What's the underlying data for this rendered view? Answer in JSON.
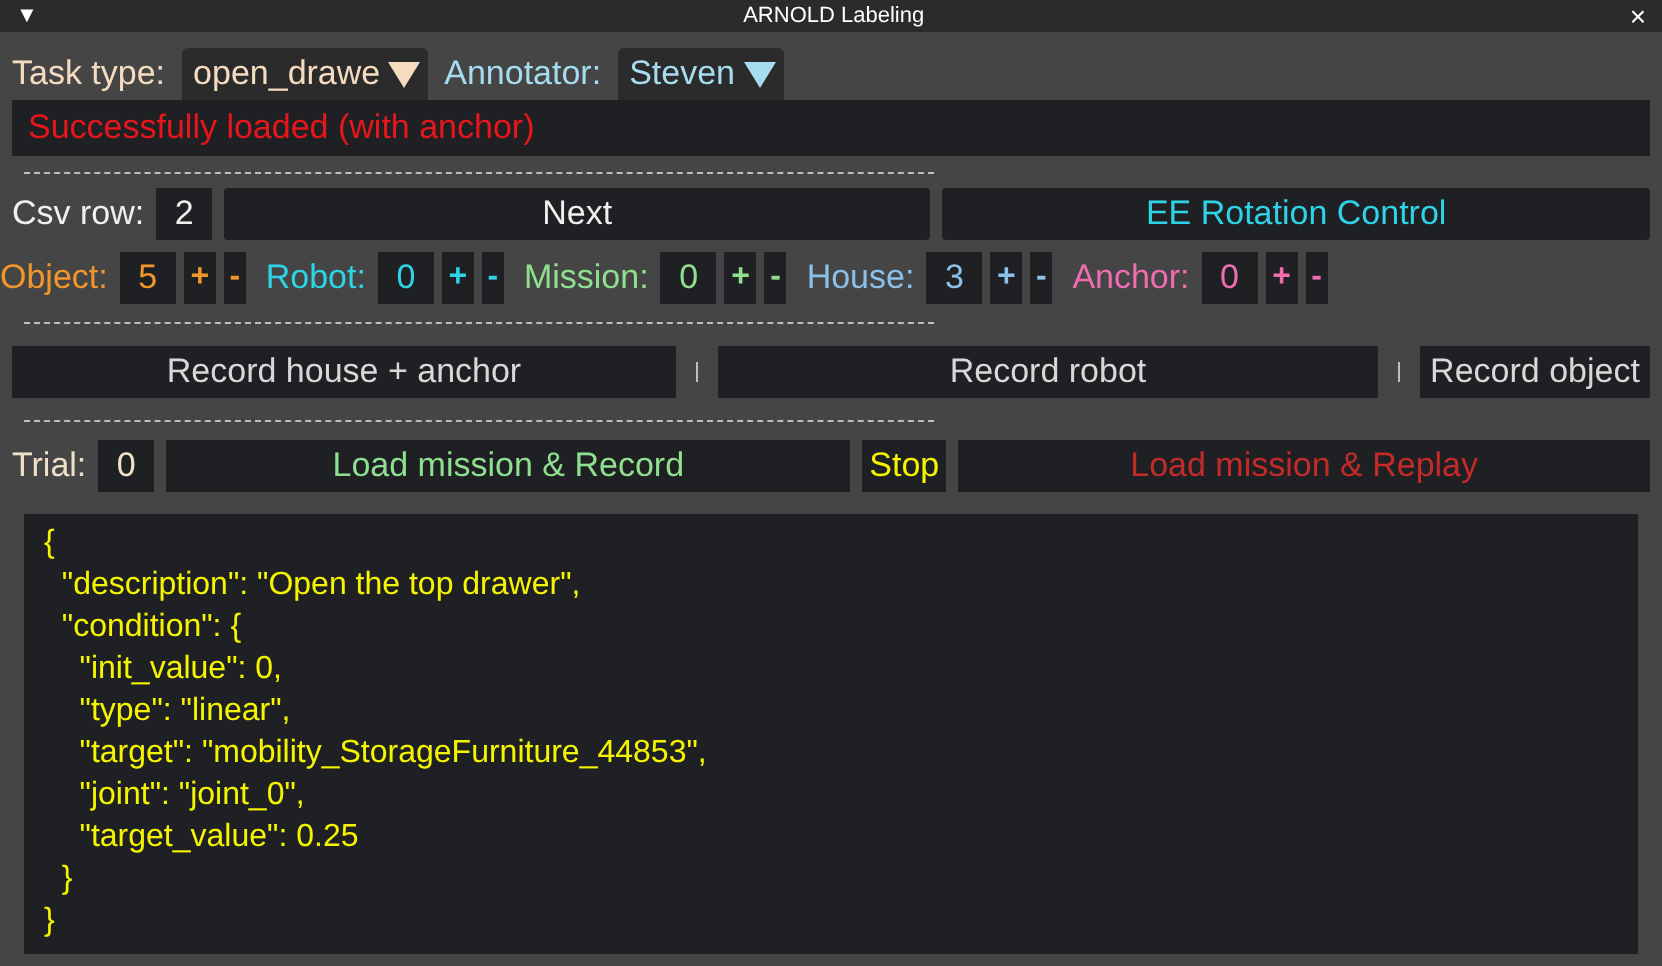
{
  "window": {
    "title": "ARNOLD Labeling",
    "collapse_glyph": "▼",
    "close_glyph": "×"
  },
  "selectors": [
    {
      "label": "Task type:",
      "value": "open_drawe",
      "color": "#f5dcc0"
    },
    {
      "label": "Annotator:",
      "value": "Steven",
      "color": "#a6dcef"
    }
  ],
  "status": "Successfully loaded (with anchor)",
  "csv_row": {
    "label": "Csv row:",
    "value": "2"
  },
  "top_buttons": [
    {
      "label": "Next",
      "kind": "plain"
    },
    {
      "label": "EE Rotation Control",
      "kind": "accent"
    }
  ],
  "counters": [
    {
      "label": "Object:",
      "value": "5",
      "color": "#f0962a"
    },
    {
      "label": "Robot:",
      "value": "0",
      "color": "#2fd3e6"
    },
    {
      "label": "Mission:",
      "value": "0",
      "color": "#8ee08e"
    },
    {
      "label": "House:",
      "value": "3",
      "color": "#8cc0e8"
    },
    {
      "label": "Anchor:",
      "value": "0",
      "color": "#f06cb0"
    }
  ],
  "counter_buttons": {
    "increment": "+",
    "decrement": "-"
  },
  "record_buttons": [
    "Record house + anchor",
    "Record robot",
    "Record object"
  ],
  "trial": {
    "label": "Trial:",
    "value": "0"
  },
  "trial_buttons": [
    {
      "label": "Load mission & Record",
      "kind": "record"
    },
    {
      "label": "Stop",
      "kind": "stop"
    },
    {
      "label": "Load mission & Replay",
      "kind": "replay"
    }
  ],
  "mission_text": [
    "{",
    "  \"description\": \"Open the top drawer\",",
    "  \"condition\": {",
    "    \"init_value\": 0,",
    "    \"type\": \"linear\",",
    "    \"target\": \"mobility_StorageFurniture_44853\",",
    "    \"joint\": \"joint_0\",",
    "    \"target_value\": 0.25",
    "  }",
    "}"
  ]
}
